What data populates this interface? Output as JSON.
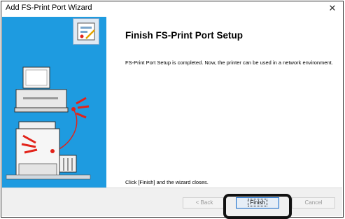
{
  "window": {
    "title": "Add FS-Print Port Wizard",
    "close_glyph": "✕"
  },
  "content": {
    "heading": "Finish FS-Print Port Setup",
    "description": "FS-Print Port Setup is completed. Now, the printer can be used in a network environment.",
    "closing_note": "Click [Finish] and the wizard closes."
  },
  "buttons": {
    "back": "< Back",
    "finish": "Finish",
    "cancel": "Cancel"
  },
  "colors": {
    "sidebar": "#1e9be0",
    "highlight_box": "#111111",
    "accent_red": "#e2231a"
  },
  "icons": {
    "header": "wizard-setup-icon",
    "illustration": "network-printer-illustration"
  }
}
